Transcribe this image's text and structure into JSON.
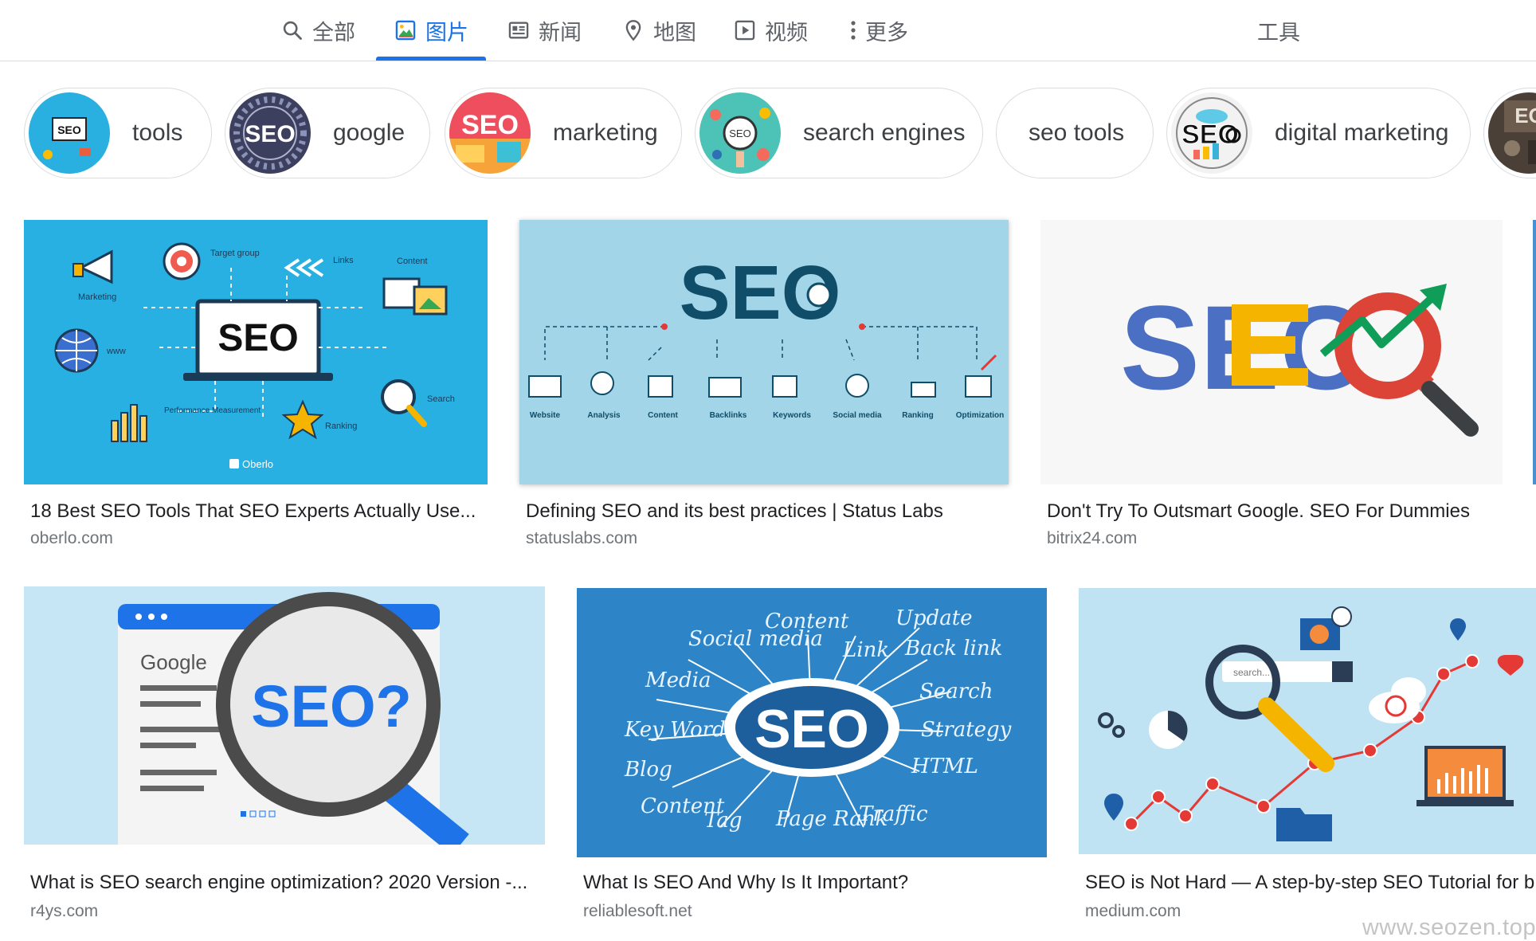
{
  "tabs": [
    {
      "label": "全部",
      "icon": "search-icon",
      "active": false
    },
    {
      "label": "图片",
      "icon": "image-icon",
      "active": true
    },
    {
      "label": "新闻",
      "icon": "news-icon",
      "active": false
    },
    {
      "label": "地图",
      "icon": "map-pin-icon",
      "active": false
    },
    {
      "label": "视频",
      "icon": "play-icon",
      "active": false
    },
    {
      "label": "更多",
      "icon": "more-vert-icon",
      "active": false
    }
  ],
  "tools_label": "工具",
  "chips": [
    {
      "label": "tools",
      "thumb_text": "SEO"
    },
    {
      "label": "google",
      "thumb_text": "SEO"
    },
    {
      "label": "marketing",
      "thumb_text": "SEO"
    },
    {
      "label": "search engines",
      "thumb_text": "SEO"
    },
    {
      "label": "seo tools"
    },
    {
      "label": "digital marketing",
      "thumb_text": "SEO"
    },
    {
      "label": "",
      "thumb_text": "EO"
    }
  ],
  "results": [
    {
      "title": "18 Best SEO Tools That SEO Experts Actually Use...",
      "source": "oberlo.com",
      "image_text": {
        "main": "SEO",
        "labels": [
          "Marketing",
          "Target group",
          "Links",
          "Content",
          "www",
          "Search",
          "Performance Measurement",
          "Ranking",
          "Oberlo"
        ]
      }
    },
    {
      "title": "Defining SEO and its best practices | Status Labs",
      "source": "statuslabs.com",
      "image_text": {
        "main": "SEO",
        "labels": [
          "Website",
          "Analysis",
          "Content",
          "Backlinks",
          "Keywords",
          "Social media",
          "Ranking",
          "Optimization"
        ]
      }
    },
    {
      "title": "Don't Try To Outsmart Google. SEO For Dummies",
      "source": "bitrix24.com",
      "image_text": {
        "main": "SEO"
      }
    },
    {
      "title": "What is SEO search engine optimization? 2020 Version -...",
      "source": "r4ys.com",
      "image_text": {
        "main": "SEO?",
        "browser": "Google"
      }
    },
    {
      "title": "What Is SEO And Why Is It Important?",
      "source": "reliablesoft.net",
      "image_text": {
        "main": "SEO",
        "words": [
          "Social media",
          "Content",
          "Link",
          "Update",
          "Back link",
          "Media",
          "Search",
          "Key Word",
          "Strategy",
          "Blog",
          "HTML",
          "Content",
          "Tag",
          "Page Rank",
          "Traffic"
        ]
      }
    },
    {
      "title": "SEO is Not Hard — A step-by-step SEO Tutorial for b",
      "source": "medium.com",
      "image_text": {
        "search": "search..."
      }
    }
  ],
  "watermark": "www.seozen.top",
  "colors": {
    "accent_blue": "#1a73e8",
    "seo_blue": "#4a6fc3",
    "seo_yellow": "#f4b400",
    "seo_red": "#db4437",
    "seo_green": "#0f9d58"
  }
}
